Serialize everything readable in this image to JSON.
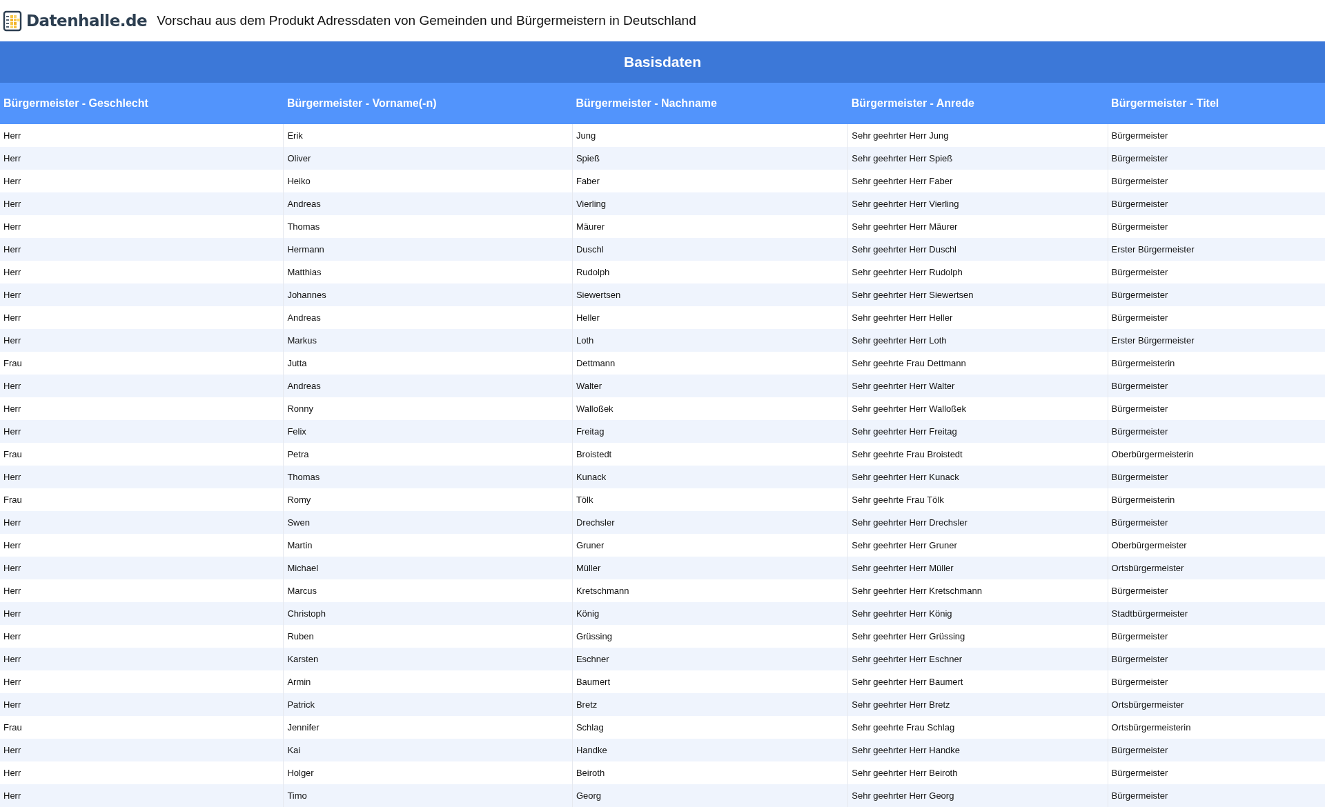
{
  "header": {
    "logo_text": "Datenhalle.de",
    "title": "Vorschau aus dem Produkt Adressdaten von Gemeinden und Bürgermeistern in Deutschland"
  },
  "table": {
    "section_title": "Basisdaten",
    "columns": [
      "Bürgermeister - Geschlecht",
      "Bürgermeister - Vorname(-n)",
      "Bürgermeister - Nachname",
      "Bürgermeister - Anrede",
      "Bürgermeister - Titel"
    ],
    "rows": [
      [
        "Herr",
        "Erik",
        "Jung",
        "Sehr geehrter Herr Jung",
        "Bürgermeister"
      ],
      [
        "Herr",
        "Oliver",
        "Spieß",
        "Sehr geehrter Herr Spieß",
        "Bürgermeister"
      ],
      [
        "Herr",
        "Heiko",
        "Faber",
        "Sehr geehrter Herr Faber",
        "Bürgermeister"
      ],
      [
        "Herr",
        "Andreas",
        "Vierling",
        "Sehr geehrter Herr Vierling",
        "Bürgermeister"
      ],
      [
        "Herr",
        "Thomas",
        "Mäurer",
        "Sehr geehrter Herr Mäurer",
        "Bürgermeister"
      ],
      [
        "Herr",
        "Hermann",
        "Duschl",
        "Sehr geehrter Herr Duschl",
        "Erster Bürgermeister"
      ],
      [
        "Herr",
        "Matthias",
        "Rudolph",
        "Sehr geehrter Herr Rudolph",
        "Bürgermeister"
      ],
      [
        "Herr",
        "Johannes",
        "Siewertsen",
        "Sehr geehrter Herr Siewertsen",
        "Bürgermeister"
      ],
      [
        "Herr",
        "Andreas",
        "Heller",
        "Sehr geehrter Herr Heller",
        "Bürgermeister"
      ],
      [
        "Herr",
        "Markus",
        "Loth",
        "Sehr geehrter Herr Loth",
        "Erster Bürgermeister"
      ],
      [
        "Frau",
        "Jutta",
        "Dettmann",
        "Sehr geehrte Frau Dettmann",
        "Bürgermeisterin"
      ],
      [
        "Herr",
        "Andreas",
        "Walter",
        "Sehr geehrter Herr Walter",
        "Bürgermeister"
      ],
      [
        "Herr",
        "Ronny",
        "Walloßek",
        "Sehr geehrter Herr Walloßek",
        "Bürgermeister"
      ],
      [
        "Herr",
        "Felix",
        "Freitag",
        "Sehr geehrter Herr Freitag",
        "Bürgermeister"
      ],
      [
        "Frau",
        "Petra",
        "Broistedt",
        "Sehr geehrte Frau Broistedt",
        "Oberbürgermeisterin"
      ],
      [
        "Herr",
        "Thomas",
        "Kunack",
        "Sehr geehrter Herr Kunack",
        "Bürgermeister"
      ],
      [
        "Frau",
        "Romy",
        "Tölk",
        "Sehr geehrte Frau Tölk",
        "Bürgermeisterin"
      ],
      [
        "Herr",
        "Swen",
        "Drechsler",
        "Sehr geehrter Herr Drechsler",
        "Bürgermeister"
      ],
      [
        "Herr",
        "Martin",
        "Gruner",
        "Sehr geehrter Herr Gruner",
        "Oberbürgermeister"
      ],
      [
        "Herr",
        "Michael",
        "Müller",
        "Sehr geehrter Herr Müller",
        "Ortsbürgermeister"
      ],
      [
        "Herr",
        "Marcus",
        "Kretschmann",
        "Sehr geehrter Herr Kretschmann",
        "Bürgermeister"
      ],
      [
        "Herr",
        "Christoph",
        "König",
        "Sehr geehrter Herr König",
        "Stadtbürgermeister"
      ],
      [
        "Herr",
        "Ruben",
        "Grüssing",
        "Sehr geehrter Herr Grüssing",
        "Bürgermeister"
      ],
      [
        "Herr",
        "Karsten",
        "Eschner",
        "Sehr geehrter Herr Eschner",
        "Bürgermeister"
      ],
      [
        "Herr",
        "Armin",
        "Baumert",
        "Sehr geehrter Herr Baumert",
        "Bürgermeister"
      ],
      [
        "Herr",
        "Patrick",
        "Bretz",
        "Sehr geehrter Herr Bretz",
        "Ortsbürgermeister"
      ],
      [
        "Frau",
        "Jennifer",
        "Schlag",
        "Sehr geehrte Frau Schlag",
        "Ortsbürgermeisterin"
      ],
      [
        "Herr",
        "Kai",
        "Handke",
        "Sehr geehrter Herr Handke",
        "Bürgermeister"
      ],
      [
        "Herr",
        "Holger",
        "Beiroth",
        "Sehr geehrter Herr Beiroth",
        "Bürgermeister"
      ],
      [
        "Herr",
        "Timo",
        "Georg",
        "Sehr geehrter Herr Georg",
        "Bürgermeister"
      ]
    ]
  }
}
